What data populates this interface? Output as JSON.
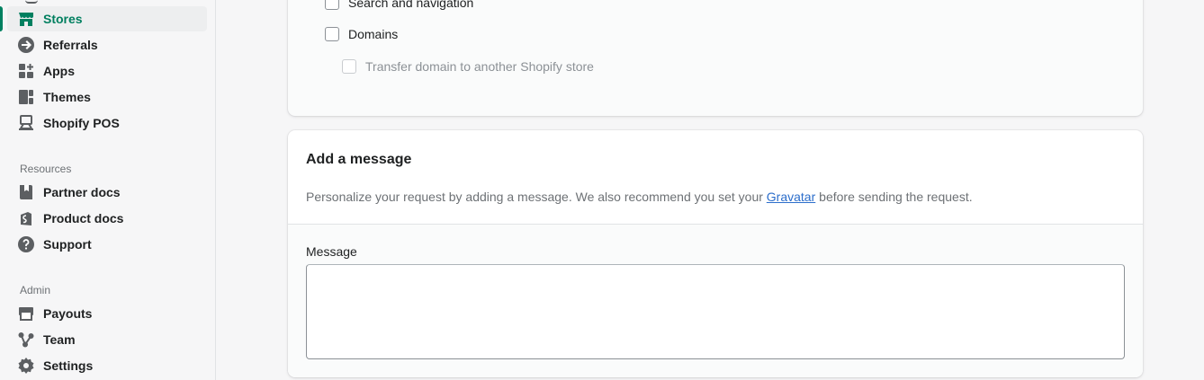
{
  "sidebar": {
    "main_items": [
      {
        "label": "Stores",
        "icon": "store-icon",
        "active": true
      },
      {
        "label": "Referrals",
        "icon": "referral-icon",
        "active": false
      },
      {
        "label": "Apps",
        "icon": "apps-icon",
        "active": false
      },
      {
        "label": "Themes",
        "icon": "themes-icon",
        "active": false
      },
      {
        "label": "Shopify POS",
        "icon": "pos-icon",
        "active": false
      }
    ],
    "resources_label": "Resources",
    "resources_items": [
      {
        "label": "Partner docs",
        "icon": "partner-docs-icon"
      },
      {
        "label": "Product docs",
        "icon": "product-docs-icon"
      },
      {
        "label": "Support",
        "icon": "support-icon"
      }
    ],
    "admin_label": "Admin",
    "admin_items": [
      {
        "label": "Payouts",
        "icon": "payouts-icon"
      },
      {
        "label": "Team",
        "icon": "team-icon"
      },
      {
        "label": "Settings",
        "icon": "settings-icon"
      }
    ],
    "accent_color": "#008060"
  },
  "permissions": {
    "items": [
      {
        "label": "Search and navigation",
        "checked": false,
        "disabled": false
      },
      {
        "label": "Domains",
        "checked": false,
        "disabled": false
      },
      {
        "label": "Transfer domain to another Shopify store",
        "checked": false,
        "disabled": true
      }
    ]
  },
  "message_card": {
    "title": "Add a message",
    "description_before": "Personalize your request by adding a message. We also recommend you set your ",
    "link_text": "Gravatar",
    "description_after": " before sending the request.",
    "field_label": "Message",
    "field_value": ""
  }
}
